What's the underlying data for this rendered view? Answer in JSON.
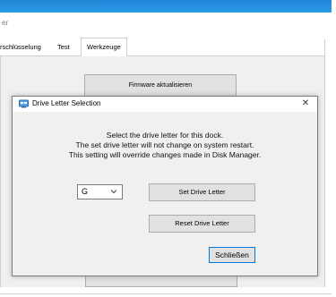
{
  "background_window": {
    "caption": "er",
    "tabs": [
      "rschlüsselung",
      "Test",
      "Werkzeuge"
    ],
    "firmware_button": "Firmware aktualisieren"
  },
  "dialog": {
    "title": "Drive Letter Selection",
    "close_symbol": "✕",
    "message_lines": [
      "Select the drive letter for this dock.",
      "The set drive letter will not change on system restart.",
      "This setting will override changes made in Disk Manager."
    ],
    "drive_select_value": "G",
    "set_button": "Set Drive Letter",
    "reset_button": "Reset Drive Letter",
    "close_button": "Schließen"
  },
  "colors": {
    "titlebar_accent": "#1f86d6",
    "default_button_border": "#0078d7"
  }
}
